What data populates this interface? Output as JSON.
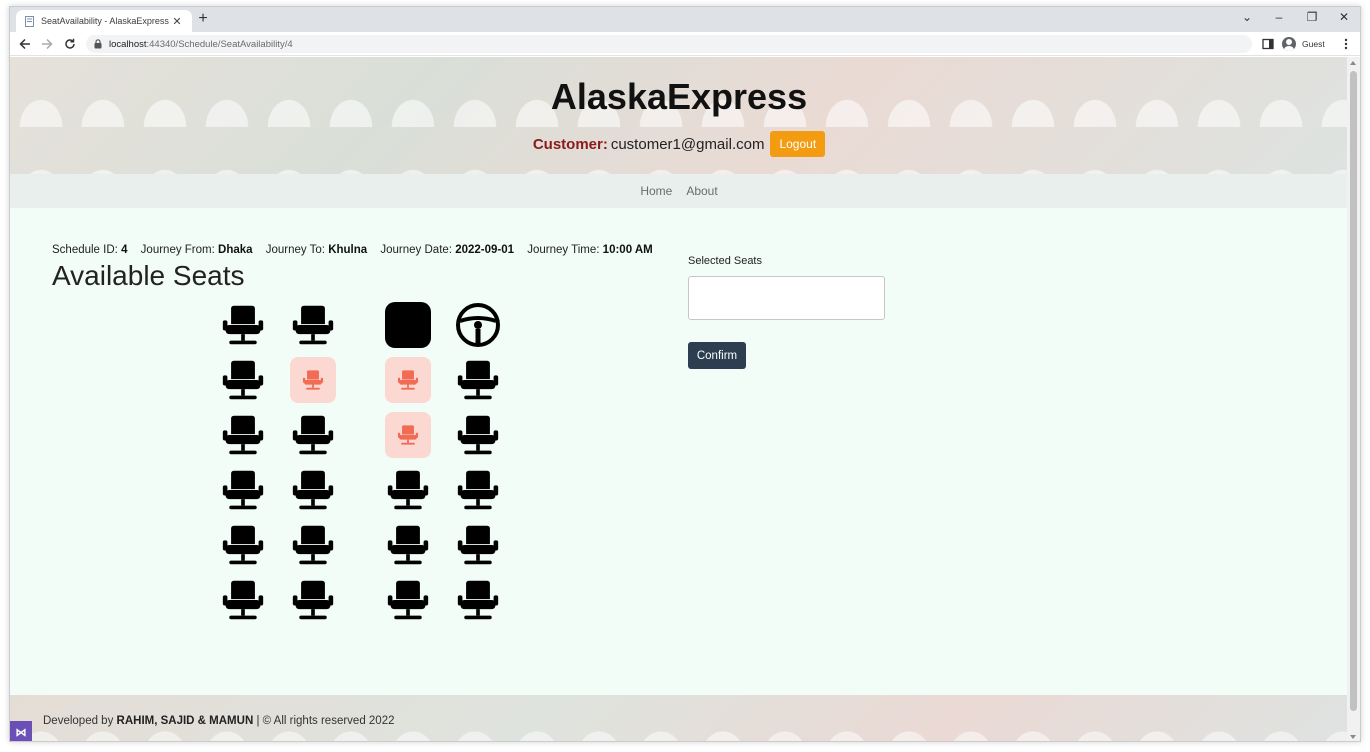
{
  "browser": {
    "tab_title": "SeatAvailability - AlaskaExpress",
    "tab_close": "✕",
    "new_tab": "+",
    "window_controls": {
      "dropdown": "⌄",
      "minimize": "–",
      "restore": "❐",
      "close": "✕"
    },
    "url_host": "localhost",
    "url_path": ":44340/Schedule/SeatAvailability/4",
    "profile_label": "Guest"
  },
  "header": {
    "title": "AlaskaExpress",
    "role_label": "Customer:",
    "email": "customer1@gmail.com",
    "logout_label": "Logout"
  },
  "nav": {
    "home": "Home",
    "about": "About"
  },
  "schedule": {
    "id_label": "Schedule ID:",
    "id": "4",
    "from_label": "Journey From:",
    "from": "Dhaka",
    "to_label": "Journey To:",
    "to": "Khulna",
    "date_label": "Journey Date:",
    "date": "2022-09-01",
    "time_label": "Journey Time:",
    "time": "10:00 AM"
  },
  "available_seats_title": "Available Seats",
  "seat_map": {
    "rows": [
      [
        "available",
        "available",
        "driver-box",
        "steering-wheel"
      ],
      [
        "available",
        "booked",
        "booked",
        "available"
      ],
      [
        "available",
        "available",
        "booked",
        "available"
      ],
      [
        "available",
        "available",
        "available",
        "available"
      ],
      [
        "available",
        "available",
        "available",
        "available"
      ],
      [
        "available",
        "available",
        "available",
        "available"
      ]
    ],
    "colors": {
      "available": "#000000",
      "booked_bg": "#fcd8d2",
      "booked_icon": "#f26b55"
    }
  },
  "selection": {
    "label": "Selected Seats",
    "value": "",
    "confirm_label": "Confirm"
  },
  "footer": {
    "prefix": "Developed by ",
    "authors": "RAHIM, SAJID & MAMUN",
    "suffix": " | © All rights reserved 2022"
  },
  "colors": {
    "logout": "#f39c12",
    "confirm": "#2c3e50",
    "role": "#8b1a1a",
    "page_bg": "#f2fdf8"
  }
}
